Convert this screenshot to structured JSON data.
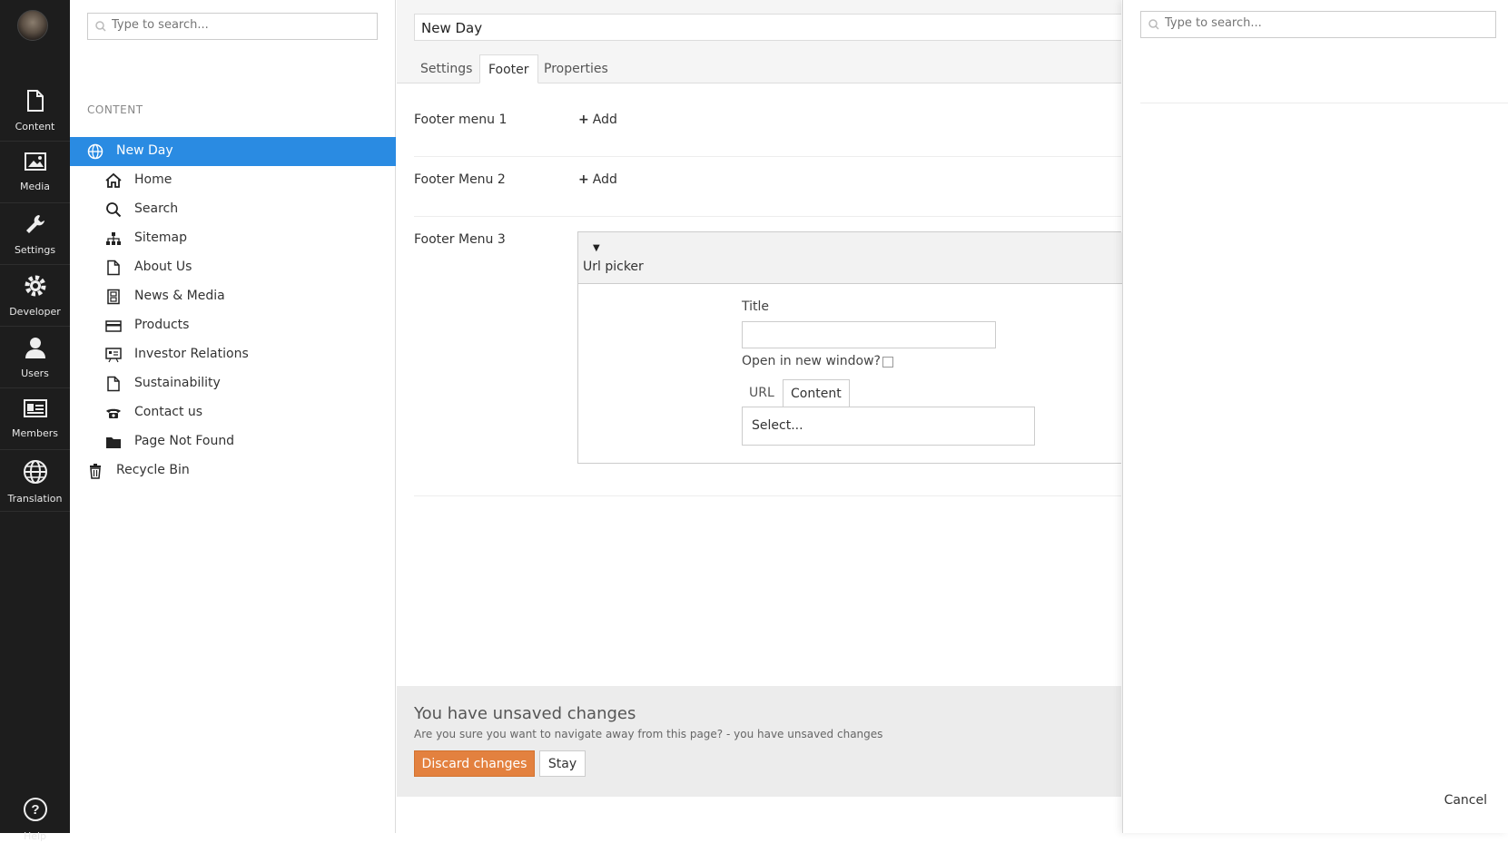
{
  "appbar": {
    "items": [
      {
        "label": "Content",
        "icon": "document-icon"
      },
      {
        "label": "Media",
        "icon": "image-icon"
      },
      {
        "label": "Settings",
        "icon": "wrench-icon"
      },
      {
        "label": "Developer",
        "icon": "gear-icon"
      },
      {
        "label": "Users",
        "icon": "user-icon"
      },
      {
        "label": "Members",
        "icon": "id-card-icon"
      },
      {
        "label": "Translation",
        "icon": "globe-icon"
      }
    ],
    "help_label": "Help"
  },
  "tree": {
    "search_placeholder": "Type to search...",
    "section_title": "CONTENT",
    "root": {
      "label": "New Day",
      "icon": "globe-icon"
    },
    "items": [
      {
        "label": "Home",
        "icon": "home-icon"
      },
      {
        "label": "Search",
        "icon": "search-icon"
      },
      {
        "label": "Sitemap",
        "icon": "sitemap-icon"
      },
      {
        "label": "About Us",
        "icon": "document-icon"
      },
      {
        "label": "News & Media",
        "icon": "film-icon"
      },
      {
        "label": "Products",
        "icon": "credit-card-icon"
      },
      {
        "label": "Investor Relations",
        "icon": "presentation-icon"
      },
      {
        "label": "Sustainability",
        "icon": "document-icon"
      },
      {
        "label": "Contact us",
        "icon": "phone-icon"
      },
      {
        "label": "Page Not Found",
        "icon": "folder-icon"
      }
    ],
    "recycle_bin": {
      "label": "Recycle Bin",
      "icon": "trash-icon"
    }
  },
  "editor": {
    "name": "New Day",
    "tabs": [
      "Settings",
      "Footer",
      "Properties"
    ],
    "active_tab": "Footer",
    "properties": [
      {
        "label": "Footer menu 1",
        "action": "Add"
      },
      {
        "label": "Footer Menu 2",
        "action": "Add"
      },
      {
        "label": "Footer Menu 3"
      }
    ],
    "urlpicker": {
      "title": "Url picker",
      "title_label": "Title",
      "title_value": "",
      "new_window_label": "Open in new window?",
      "new_window_checked": false,
      "tabs": [
        "URL",
        "Content"
      ],
      "active_tab": "Content",
      "select_value": "Select..."
    }
  },
  "unsaved": {
    "heading": "You have unsaved changes",
    "message": "Are you sure you want to navigate away from this page? - you have unsaved changes",
    "discard_label": "Discard changes",
    "stay_label": "Stay"
  },
  "dialog": {
    "search_placeholder": "Type to search...",
    "cancel_label": "Cancel"
  },
  "colors": {
    "appbar_bg": "#1d1d1d",
    "selected_bg": "#2a8be2",
    "discard_btn": "#e3813f"
  }
}
